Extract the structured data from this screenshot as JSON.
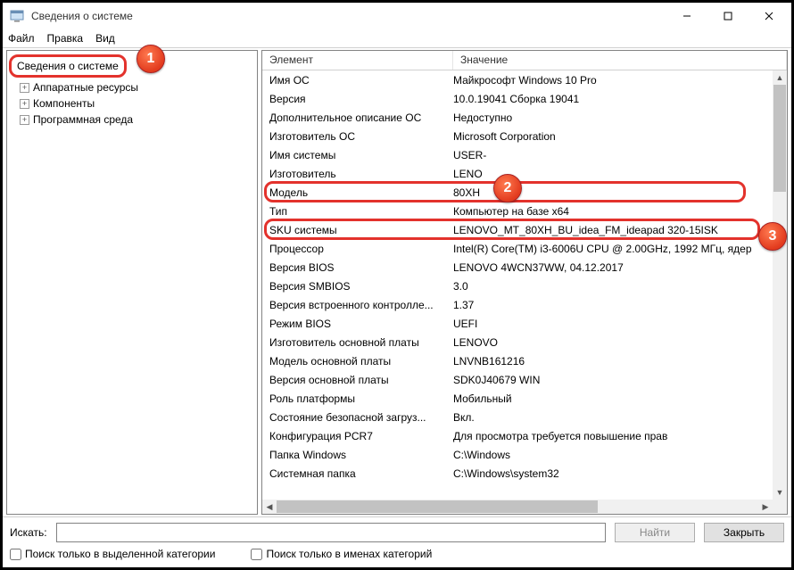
{
  "window": {
    "title": "Сведения о системе"
  },
  "menu": {
    "file": "Файл",
    "edit": "Правка",
    "view": "Вид"
  },
  "tree": {
    "root": "Сведения о системе",
    "items": [
      "Аппаратные ресурсы",
      "Компоненты",
      "Программная среда"
    ]
  },
  "columns": {
    "element": "Элемент",
    "value": "Значение"
  },
  "rows": [
    {
      "e": "Имя ОС",
      "v": "Майкрософт Windows 10 Pro"
    },
    {
      "e": "Версия",
      "v": "10.0.19041 Сборка 19041"
    },
    {
      "e": "Дополнительное описание ОС",
      "v": "Недоступно"
    },
    {
      "e": "Изготовитель ОС",
      "v": "Microsoft Corporation"
    },
    {
      "e": "Имя системы",
      "v": "USER-"
    },
    {
      "e": "Изготовитель",
      "v": "LENO"
    },
    {
      "e": "Модель",
      "v": "80XH"
    },
    {
      "e": "Тип",
      "v": "Компьютер на базе x64"
    },
    {
      "e": "SKU системы",
      "v": "LENOVO_MT_80XH_BU_idea_FM_ideapad 320-15ISK"
    },
    {
      "e": "Процессор",
      "v": "Intel(R) Core(TM) i3-6006U CPU @ 2.00GHz, 1992 МГц, ядер"
    },
    {
      "e": "Версия BIOS",
      "v": "LENOVO 4WCN37WW, 04.12.2017"
    },
    {
      "e": "Версия SMBIOS",
      "v": "3.0"
    },
    {
      "e": "Версия встроенного контролле...",
      "v": "1.37"
    },
    {
      "e": "Режим BIOS",
      "v": "UEFI"
    },
    {
      "e": "Изготовитель основной платы",
      "v": "LENOVO"
    },
    {
      "e": "Модель основной платы",
      "v": "LNVNB161216"
    },
    {
      "e": "Версия основной платы",
      "v": "SDK0J40679 WIN"
    },
    {
      "e": "Роль платформы",
      "v": "Мобильный"
    },
    {
      "e": "Состояние безопасной загруз...",
      "v": "Вкл."
    },
    {
      "e": "Конфигурация PCR7",
      "v": "Для просмотра требуется повышение прав"
    },
    {
      "e": "Папка Windows",
      "v": "C:\\Windows"
    },
    {
      "e": "Системная папка",
      "v": "C:\\Windows\\system32"
    }
  ],
  "search": {
    "label": "Искать:",
    "find": "Найти",
    "close": "Закрыть",
    "only_cat": "Поиск только в выделенной категории",
    "only_names": "Поиск только в именах категорий"
  },
  "callouts": {
    "one": "1",
    "two": "2",
    "three": "3"
  }
}
